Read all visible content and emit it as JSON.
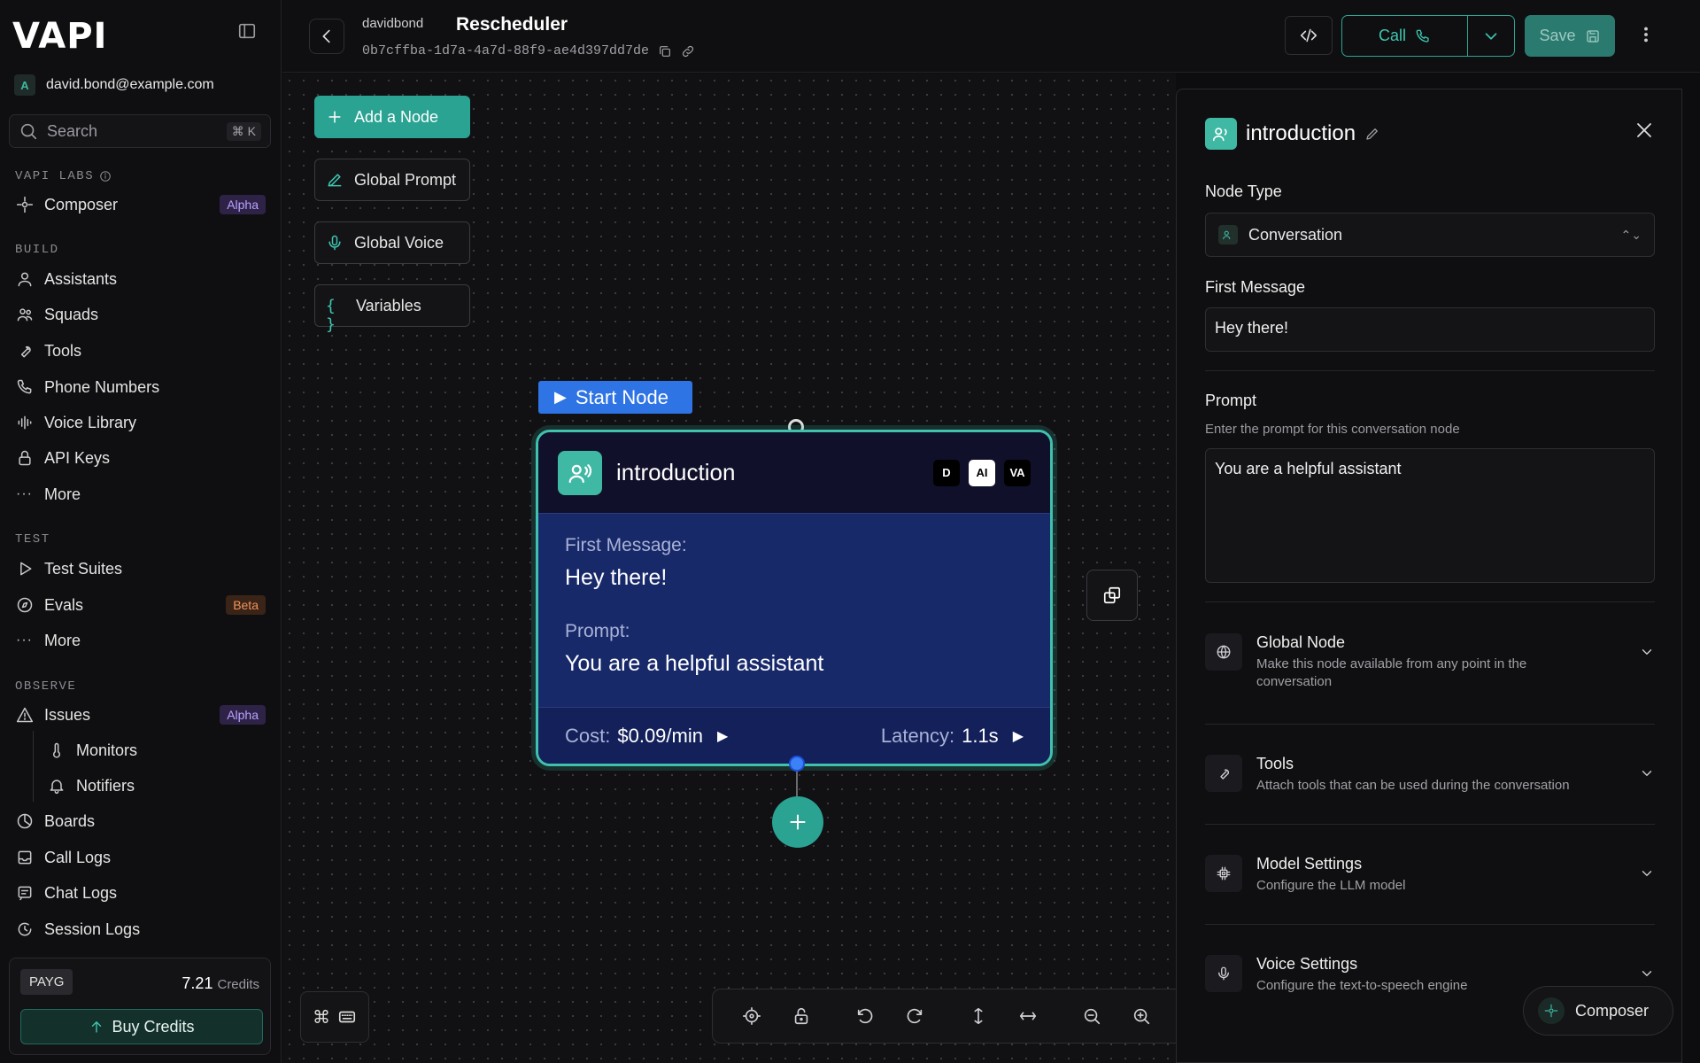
{
  "brand": {
    "logo_text": "VAPI"
  },
  "account": {
    "initial": "A",
    "email": "david.bond@example.com"
  },
  "search": {
    "placeholder": "Search",
    "shortcut": "⌘ K"
  },
  "sidebar": {
    "labs": {
      "title": "VAPI LABS",
      "items": [
        {
          "label": "Composer",
          "badge": "Alpha"
        }
      ]
    },
    "build": {
      "title": "BUILD",
      "items": [
        "Assistants",
        "Squads",
        "Tools",
        "Phone Numbers",
        "Voice Library",
        "API Keys",
        "More"
      ]
    },
    "test": {
      "title": "TEST",
      "items": [
        "Test Suites",
        "Evals",
        "More"
      ],
      "evals_badge": "Beta"
    },
    "observe": {
      "title": "OBSERVE",
      "items": [
        "Issues",
        "Monitors",
        "Notifiers",
        "Boards",
        "Call Logs",
        "Chat Logs",
        "Session Logs"
      ],
      "issues_badge": "Alpha"
    }
  },
  "billing": {
    "plan": "PAYG",
    "credits_value": "7.21",
    "credits_unit": "Credits",
    "buy_label": "Buy Credits"
  },
  "header": {
    "org": "davidbond",
    "title": "Rescheduler",
    "workflow_id": "0b7cffba-1d7a-4a7d-88f9-ae4d397dd7de",
    "call_label": "Call",
    "save_label": "Save"
  },
  "canvas": {
    "tools": [
      "Add a Node",
      "Global Prompt",
      "Global Voice",
      "Variables"
    ],
    "start_tag": "Start Node",
    "node": {
      "title": "introduction",
      "providers": [
        "D",
        "AI",
        "VA"
      ],
      "first_message_label": "First Message:",
      "first_message": "Hey there!",
      "prompt_label": "Prompt:",
      "prompt": "You are a helpful assistant",
      "cost_label": "Cost:",
      "cost": "$0.09/min",
      "latency_label": "Latency:",
      "latency": "1.1s"
    }
  },
  "panel": {
    "title": "introduction",
    "node_type_label": "Node Type",
    "node_type_value": "Conversation",
    "first_message_label": "First Message",
    "first_message_value": "Hey there!",
    "prompt_label": "Prompt",
    "prompt_hint": "Enter the prompt for this conversation node",
    "prompt_value": "You are a helpful assistant",
    "sections": [
      {
        "title": "Global Node",
        "desc": "Make this node available from any point in the conversation"
      },
      {
        "title": "Tools",
        "desc": "Attach tools that can be used during the conversation"
      },
      {
        "title": "Model Settings",
        "desc": "Configure the LLM model"
      },
      {
        "title": "Voice Settings",
        "desc": "Configure the text-to-speech engine"
      }
    ]
  },
  "composer": {
    "label": "Composer"
  },
  "colors": {
    "accent": "#2ba393",
    "node_bg": "#18296a",
    "start_tag": "#2e74e4",
    "alpha_badge": "#b9a2ff",
    "beta_badge": "#f0925a"
  }
}
